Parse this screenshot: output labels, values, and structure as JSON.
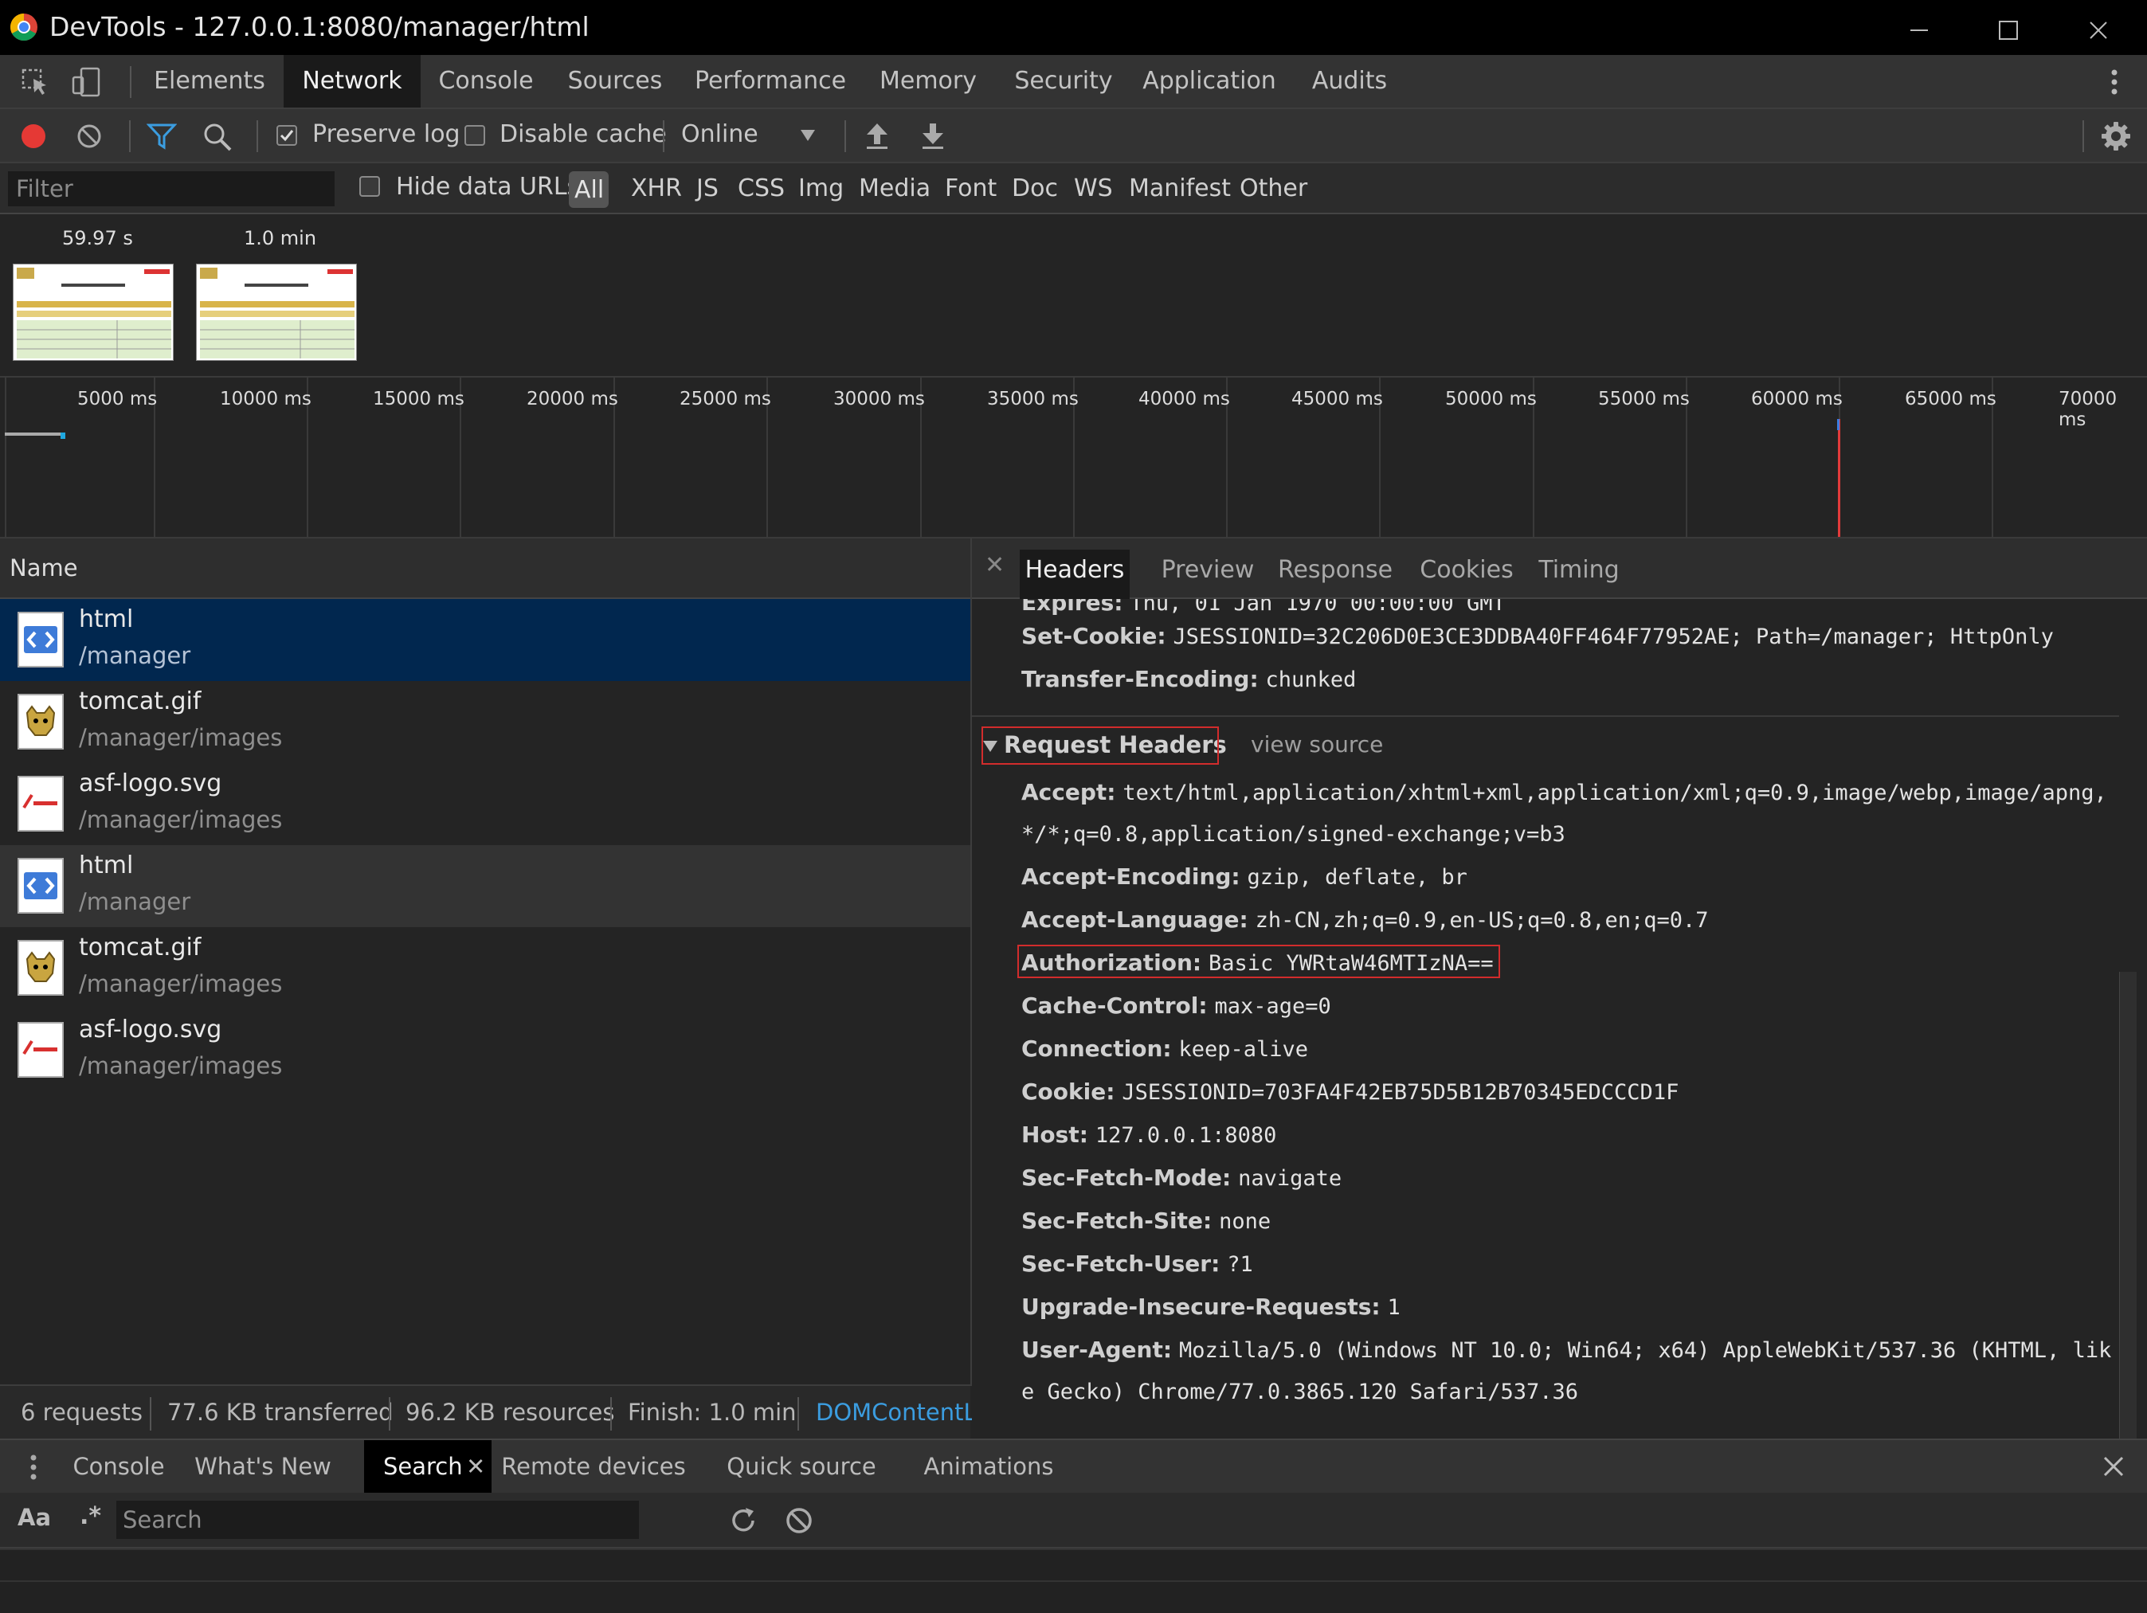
{
  "window": {
    "title": "DevTools - 127.0.0.1:8080/manager/html"
  },
  "panel_tabs": [
    "Elements",
    "Network",
    "Console",
    "Sources",
    "Performance",
    "Memory",
    "Security",
    "Application",
    "Audits"
  ],
  "active_panel": "Network",
  "toolbar": {
    "preserve_log": "Preserve log",
    "preserve_log_checked": true,
    "disable_cache": "Disable cache",
    "disable_cache_checked": false,
    "throttle": "Online"
  },
  "filter": {
    "placeholder": "Filter",
    "hide_data_urls": "Hide data URLs",
    "types": [
      "All",
      "XHR",
      "JS",
      "CSS",
      "Img",
      "Media",
      "Font",
      "Doc",
      "WS",
      "Manifest",
      "Other"
    ],
    "active_type": "All"
  },
  "screenshots": [
    {
      "time": "59.97 s"
    },
    {
      "time": "1.0 min"
    }
  ],
  "overview_ticks": [
    "5000 ms",
    "10000 ms",
    "15000 ms",
    "20000 ms",
    "25000 ms",
    "30000 ms",
    "35000 ms",
    "40000 ms",
    "45000 ms",
    "50000 ms",
    "55000 ms",
    "60000 ms",
    "65000 ms",
    "70000 ms"
  ],
  "request_list": {
    "column_header": "Name",
    "rows": [
      {
        "name": "html",
        "path": "/manager",
        "icon": "html-document-icon",
        "state": "selected"
      },
      {
        "name": "tomcat.gif",
        "path": "/manager/images",
        "icon": "tomcat-image-icon",
        "state": "normal"
      },
      {
        "name": "asf-logo.svg",
        "path": "/manager/images",
        "icon": "apache-image-icon",
        "state": "normal"
      },
      {
        "name": "html",
        "path": "/manager",
        "icon": "html-document-icon",
        "state": "hover"
      },
      {
        "name": "tomcat.gif",
        "path": "/manager/images",
        "icon": "tomcat-image-icon",
        "state": "normal"
      },
      {
        "name": "asf-logo.svg",
        "path": "/manager/images",
        "icon": "apache-image-icon",
        "state": "normal"
      }
    ]
  },
  "status": {
    "requests": "6 requests",
    "transferred": "77.6 KB transferred",
    "resources": "96.2 KB resources",
    "finish": "Finish: 1.0 min",
    "dom": "DOMContentL"
  },
  "details": {
    "tabs": [
      "Headers",
      "Preview",
      "Response",
      "Cookies",
      "Timing"
    ],
    "active_tab": "Headers",
    "response_headers": [
      {
        "key": "Expires:",
        "value": "Thu, 01 Jan 1970 00:00:00 GMT"
      },
      {
        "key": "Set-Cookie:",
        "value": "JSESSIONID=32C206D0E3CE3DDBA40FF464F77952AE; Path=/manager; HttpOnly"
      },
      {
        "key": "Transfer-Encoding:",
        "value": "chunked"
      }
    ],
    "request_section": {
      "title": "Request Headers",
      "view_source": "view source"
    },
    "request_headers": [
      {
        "key": "Accept:",
        "value": "text/html,application/xhtml+xml,application/xml;q=0.9,image/webp,image/apng,",
        "value2": "*/*;q=0.8,application/signed-exchange;v=b3"
      },
      {
        "key": "Accept-Encoding:",
        "value": "gzip, deflate, br"
      },
      {
        "key": "Accept-Language:",
        "value": "zh-CN,zh;q=0.9,en-US;q=0.8,en;q=0.7"
      },
      {
        "key": "Authorization:",
        "value": "Basic YWRtaW46MTIzNA=="
      },
      {
        "key": "Cache-Control:",
        "value": "max-age=0"
      },
      {
        "key": "Connection:",
        "value": "keep-alive"
      },
      {
        "key": "Cookie:",
        "value": "JSESSIONID=703FA4F42EB75D5B12B70345EDCCCD1F"
      },
      {
        "key": "Host:",
        "value": "127.0.0.1:8080"
      },
      {
        "key": "Sec-Fetch-Mode:",
        "value": "navigate"
      },
      {
        "key": "Sec-Fetch-Site:",
        "value": "none"
      },
      {
        "key": "Sec-Fetch-User:",
        "value": "?1"
      },
      {
        "key": "Upgrade-Insecure-Requests:",
        "value": "1"
      },
      {
        "key": "User-Agent:",
        "value": "Mozilla/5.0 (Windows NT 10.0; Win64; x64) AppleWebKit/537.36 (KHTML, lik",
        "value2": "e Gecko) Chrome/77.0.3865.120 Safari/537.36"
      }
    ]
  },
  "drawer": {
    "tabs": [
      "Console",
      "What's New",
      "Search",
      "Remote devices",
      "Quick source",
      "Animations"
    ],
    "active_tab": "Search",
    "match_case": "Aa",
    "regex": ".*",
    "search_placeholder": "Search"
  },
  "colors": {
    "selected_row": "#01274f",
    "highlight_box": "#d22c2c",
    "record_button": "#e53935",
    "filter_icon": "#3b9de0"
  }
}
